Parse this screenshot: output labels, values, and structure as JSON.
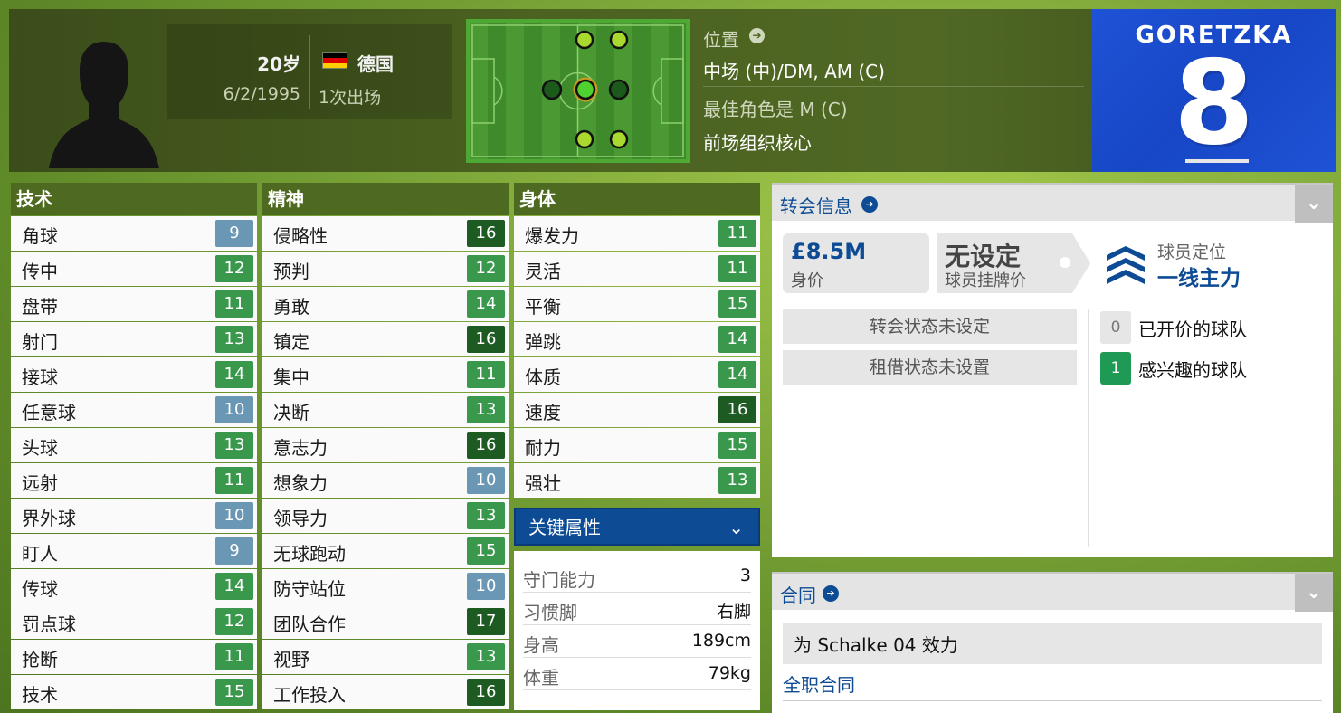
{
  "player": {
    "age": "20岁",
    "dob": "6/2/1995",
    "nation": "德国",
    "appearances": "1次出场",
    "flag_colors": [
      "#000000",
      "#dd0000",
      "#ffce00"
    ]
  },
  "position": {
    "label": "位置",
    "value": "中场 (中)/DM, AM (C)",
    "best_role": "最佳角色是 M (C)",
    "role_name": "前场组织核心"
  },
  "shirt": {
    "name": "GORETZKA",
    "number": "8",
    "color": "#1f52d6"
  },
  "technical": {
    "title": "技术",
    "attributes": [
      {
        "name": "角球",
        "value": "9"
      },
      {
        "name": "传中",
        "value": "12"
      },
      {
        "name": "盘带",
        "value": "11"
      },
      {
        "name": "射门",
        "value": "13"
      },
      {
        "name": "接球",
        "value": "14"
      },
      {
        "name": "任意球",
        "value": "10"
      },
      {
        "name": "头球",
        "value": "13"
      },
      {
        "name": "远射",
        "value": "11"
      },
      {
        "name": "界外球",
        "value": "10"
      },
      {
        "name": "盯人",
        "value": "9"
      },
      {
        "name": "传球",
        "value": "14"
      },
      {
        "name": "罚点球",
        "value": "12"
      },
      {
        "name": "抢断",
        "value": "11"
      },
      {
        "name": "技术",
        "value": "15"
      }
    ]
  },
  "mental": {
    "title": "精神",
    "attributes": [
      {
        "name": "侵略性",
        "value": "16"
      },
      {
        "name": "预判",
        "value": "12"
      },
      {
        "name": "勇敢",
        "value": "14"
      },
      {
        "name": "镇定",
        "value": "16"
      },
      {
        "name": "集中",
        "value": "11"
      },
      {
        "name": "决断",
        "value": "13"
      },
      {
        "name": "意志力",
        "value": "16"
      },
      {
        "name": "想象力",
        "value": "10"
      },
      {
        "name": "领导力",
        "value": "13"
      },
      {
        "name": "无球跑动",
        "value": "15"
      },
      {
        "name": "防守站位",
        "value": "10"
      },
      {
        "name": "团队合作",
        "value": "17"
      },
      {
        "name": "视野",
        "value": "13"
      },
      {
        "name": "工作投入",
        "value": "16"
      }
    ]
  },
  "physical": {
    "title": "身体",
    "attributes": [
      {
        "name": "爆发力",
        "value": "11"
      },
      {
        "name": "灵活",
        "value": "11"
      },
      {
        "name": "平衡",
        "value": "15"
      },
      {
        "name": "弹跳",
        "value": "14"
      },
      {
        "name": "体质",
        "value": "14"
      },
      {
        "name": "速度",
        "value": "16"
      },
      {
        "name": "耐力",
        "value": "15"
      },
      {
        "name": "强壮",
        "value": "13"
      }
    ]
  },
  "key_attributes": {
    "title": "关键属性",
    "rows": [
      {
        "label": "守门能力",
        "value": "3"
      },
      {
        "label": "习惯脚",
        "value": "右脚"
      },
      {
        "label": "身高",
        "value": "189cm"
      },
      {
        "label": "体重",
        "value": "79kg"
      }
    ]
  },
  "transfer": {
    "title": "转会信息",
    "value_amount": "£8.5M",
    "value_label": "身价",
    "asking_amount": "无设定",
    "asking_label": "球员挂牌价",
    "squad_status_label": "球员定位",
    "squad_status_value": "一线主力",
    "transfer_status": "转会状态未设定",
    "loan_status": "租借状态未设置",
    "bids_count": "0",
    "bids_label": "已开价的球队",
    "interested_count": "1",
    "interested_label": "感兴趣的球队"
  },
  "contract": {
    "title": "合同",
    "club_line": "为 Schalke 04 效力",
    "type": "全职合同"
  }
}
